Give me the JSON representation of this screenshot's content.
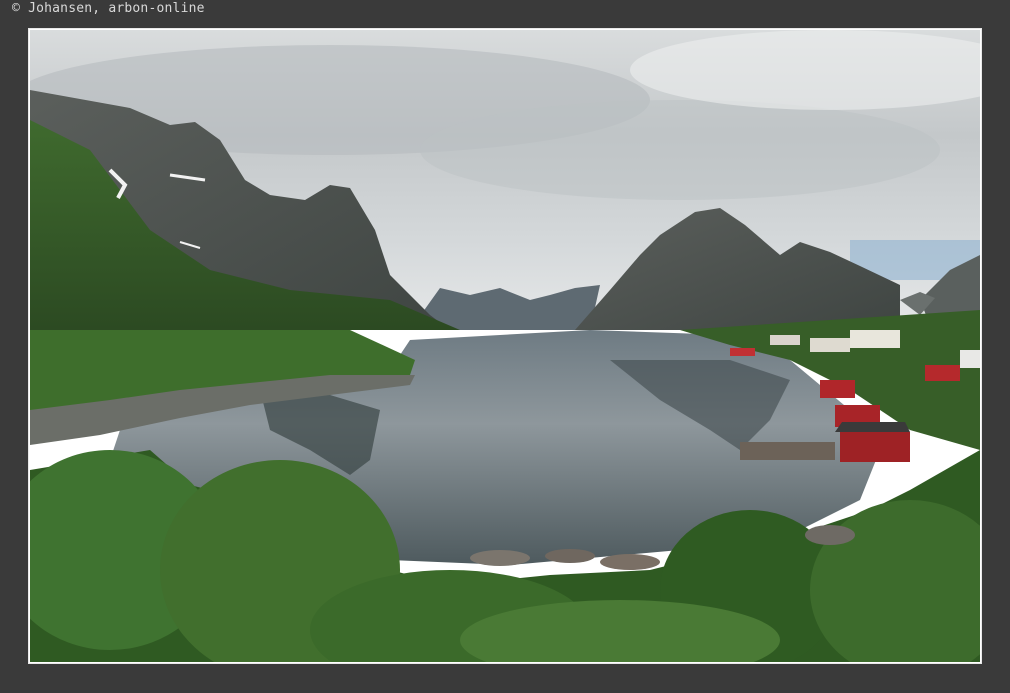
{
  "caption": {
    "copyright_symbol": "©",
    "text": "Johansen, arbon-online"
  },
  "photo": {
    "subject": "fjord village with steep mountains under cloudy sky"
  },
  "colors": {
    "background": "#3a3a3a",
    "frame_border": "#e8e8e8",
    "caption_text": "#d8d8d8"
  }
}
